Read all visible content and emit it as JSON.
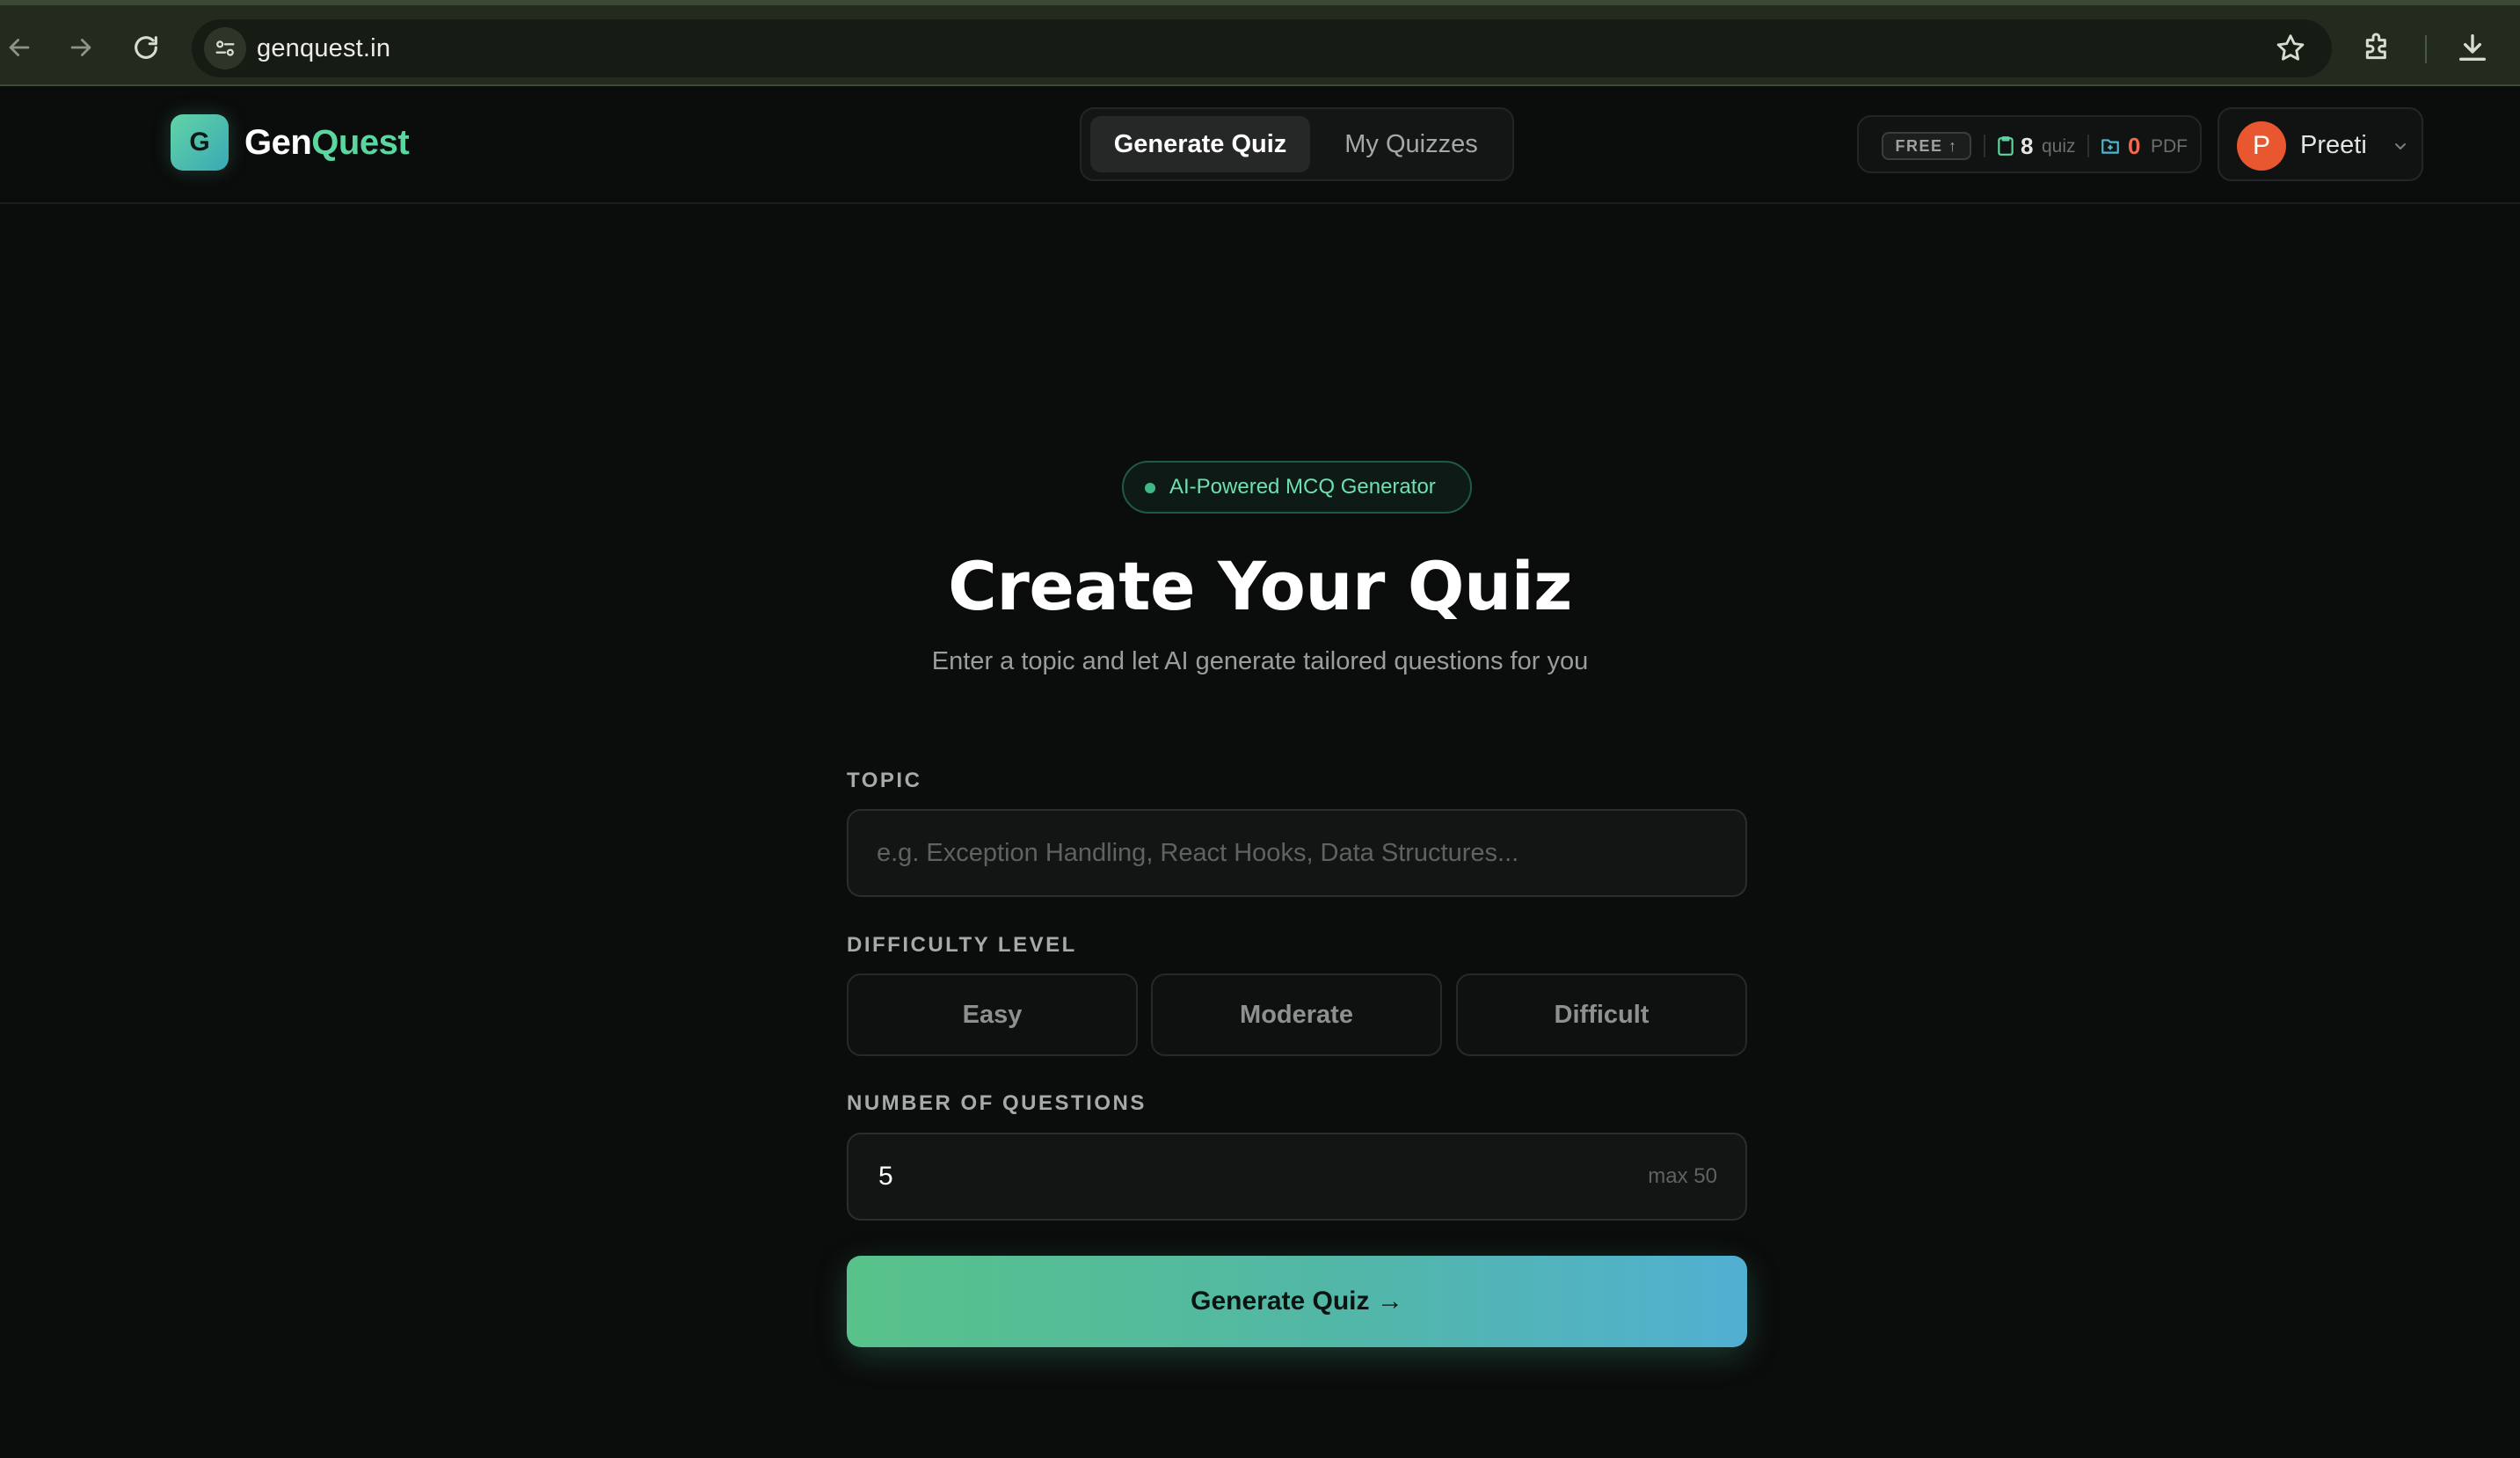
{
  "browser": {
    "url": "genquest.in"
  },
  "header": {
    "logo_letter": "G",
    "brand_part1": "Gen",
    "brand_part2": "Quest",
    "tabs": [
      {
        "label": "Generate Quiz",
        "active": true
      },
      {
        "label": "My Quizzes",
        "active": false
      }
    ],
    "usage": {
      "plan": "FREE ↑",
      "quiz_count": "8",
      "quiz_unit": "quiz",
      "pdf_count": "0",
      "pdf_unit": "PDF"
    },
    "user": {
      "initial": "P",
      "name": "Preeti"
    }
  },
  "main": {
    "badge": "AI-Powered MCQ Generator",
    "title": "Create Your Quiz",
    "subtitle": "Enter a topic and let AI generate tailored questions for you",
    "topic": {
      "label": "TOPIC",
      "value": "",
      "placeholder": "e.g. Exception Handling, React Hooks, Data Structures..."
    },
    "difficulty": {
      "label": "DIFFICULTY LEVEL",
      "options": [
        "Easy",
        "Moderate",
        "Difficult"
      ]
    },
    "questions": {
      "label": "NUMBER OF QUESTIONS",
      "value": "5",
      "hint": "max 50"
    },
    "submit_label": "Generate Quiz →"
  },
  "colors": {
    "accent_green": "#5cd6a0",
    "accent_blue": "#51b0d2",
    "avatar": "#e8572f",
    "pdf_count": "#f26a4b",
    "background": "#0b0c0c"
  },
  "icons": [
    "back-arrow-icon",
    "forward-arrow-icon",
    "reload-icon",
    "site-settings-icon",
    "bookmark-star-icon",
    "extensions-icon",
    "download-icon",
    "clipboard-icon",
    "pdf-file-icon",
    "chevron-down-icon"
  ]
}
